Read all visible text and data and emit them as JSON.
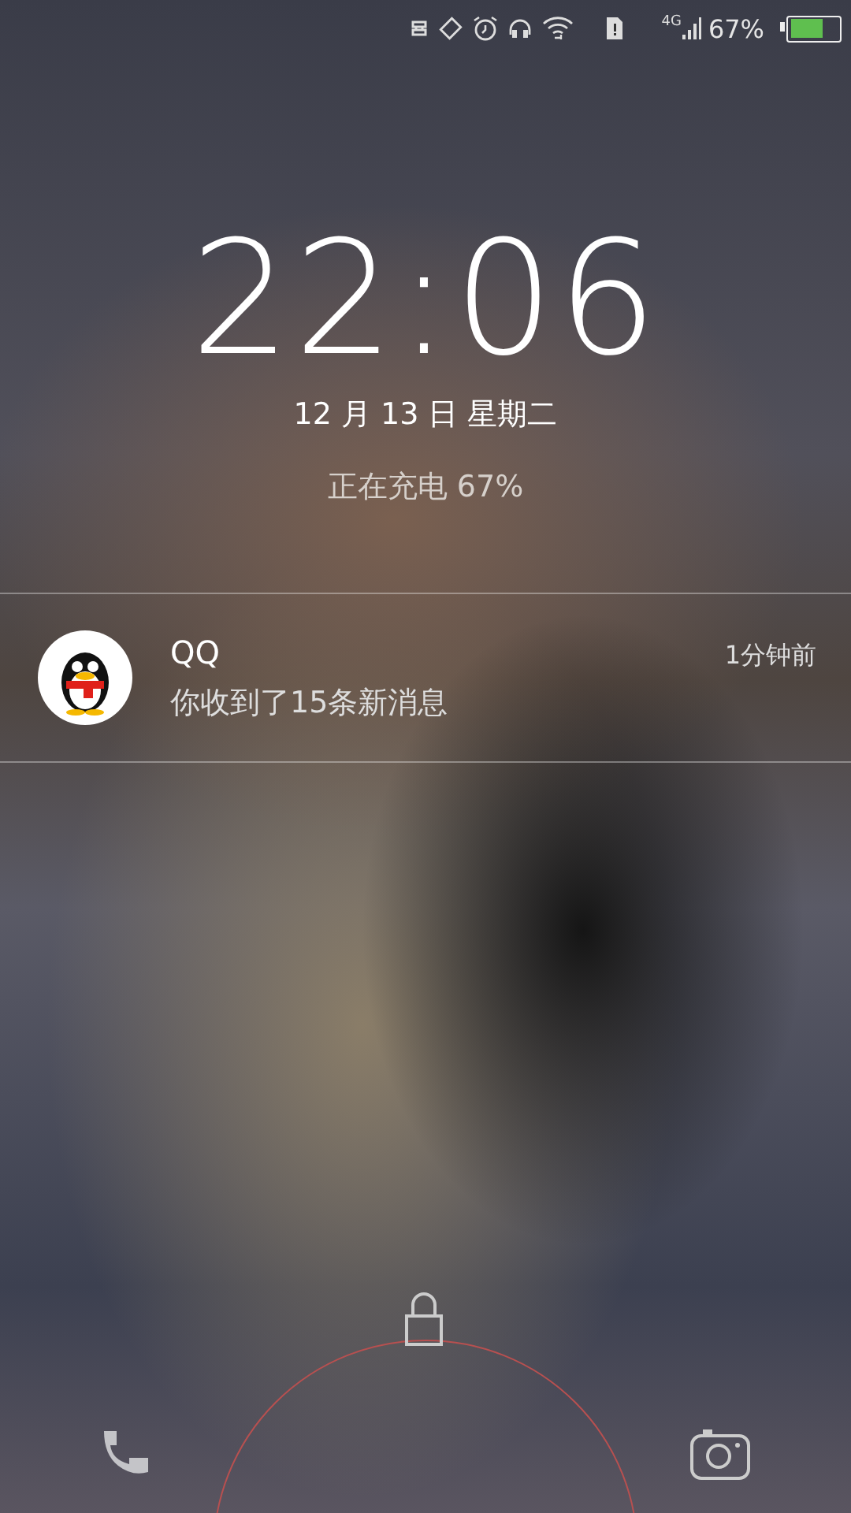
{
  "status_bar": {
    "network": "4G",
    "battery_text": "67%",
    "battery": {
      "level": 0.67
    }
  },
  "clock": {
    "time": "22:06",
    "date": "12 月 13 日 星期二",
    "charging": "正在充电 67%"
  },
  "notifications": [
    {
      "app": "QQ",
      "time": "1分钟前",
      "message": "你收到了15条新消息"
    }
  ]
}
